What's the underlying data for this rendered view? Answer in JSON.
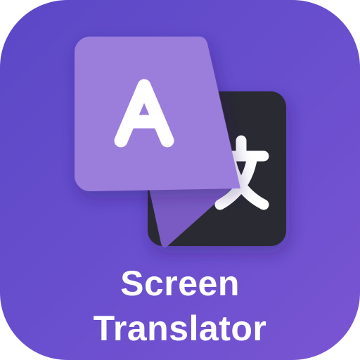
{
  "app": {
    "name_line1": "Screen",
    "name_line2": "Translator"
  },
  "icon": {
    "source_glyph": "A",
    "target_glyph_icon": "cjk-wen-character-icon",
    "source_card_icon": "latin-letter-card-icon",
    "target_card_icon": "dark-translation-card-icon"
  },
  "colors": {
    "background_gradient_start": "#5b48c6",
    "background_gradient_end": "#7a55d2",
    "front_card": "#9b7ddc",
    "front_card_fold": "#7a5bc4",
    "back_card": "#2b2a33",
    "glyph": "#ffffff"
  }
}
